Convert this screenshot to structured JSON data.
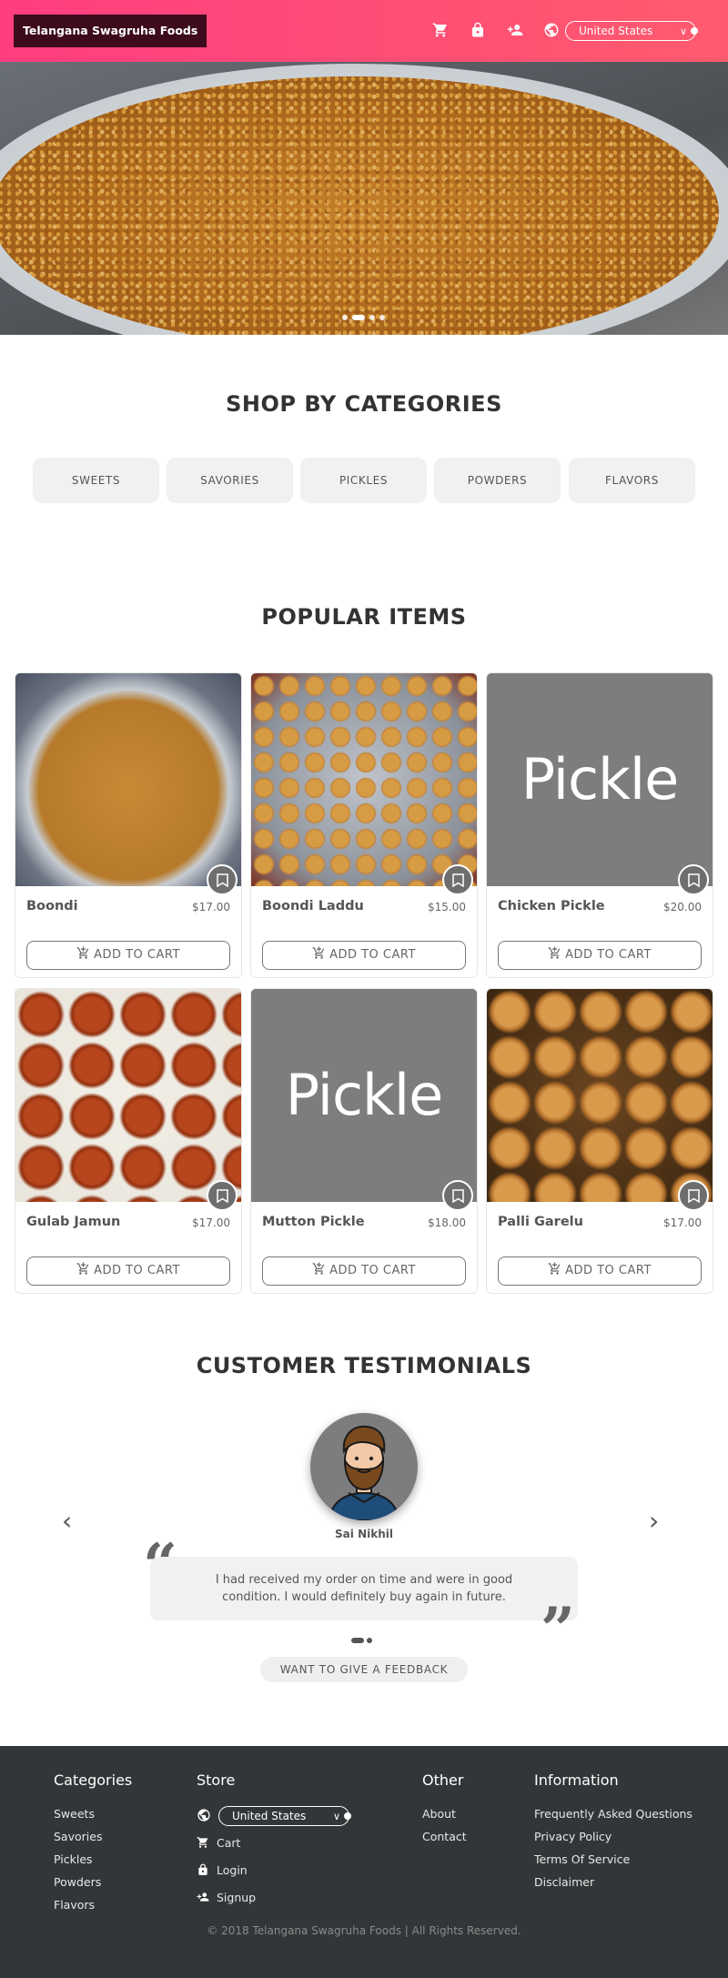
{
  "header": {
    "brand": "Telangana Swagruha Foods",
    "country": "United States",
    "icons": [
      "cart-icon",
      "lock-icon",
      "add-user-icon",
      "globe-icon"
    ]
  },
  "hero": {
    "slides": 4,
    "active_slide": 2
  },
  "categories": {
    "title": "SHOP BY CATEGORIES",
    "items": [
      "SWEETS",
      "SAVORIES",
      "PICKLES",
      "POWDERS",
      "FLAVORS"
    ]
  },
  "popular": {
    "title": "POPULAR ITEMS",
    "add_label": "ADD TO CART",
    "items": [
      {
        "name": "Boondi",
        "price": "$17.00",
        "image": "boondi"
      },
      {
        "name": "Boondi Laddu",
        "price": "$15.00",
        "image": "laddu"
      },
      {
        "name": "Chicken Pickle",
        "price": "$20.00",
        "image": "pickle",
        "image_text": "Pickle"
      },
      {
        "name": "Gulab Jamun",
        "price": "$17.00",
        "image": "jamun"
      },
      {
        "name": "Mutton Pickle",
        "price": "$18.00",
        "image": "pickle",
        "image_text": "Pickle"
      },
      {
        "name": "Palli Garelu",
        "price": "$17.00",
        "image": "garelu"
      }
    ]
  },
  "testimonials": {
    "title": "CUSTOMER TESTIMONIALS",
    "name": "Sai Nikhil",
    "quote": "I had received my order on time and were in good condition. I would definitely buy again in future.",
    "slides": 2,
    "active_slide": 1,
    "feedback_label": "WANT TO GIVE A FEEDBACK"
  },
  "footer": {
    "categories": {
      "title": "Categories",
      "links": [
        "Sweets",
        "Savories",
        "Pickles",
        "Powders",
        "Flavors"
      ]
    },
    "store": {
      "title": "Store",
      "country": "United States",
      "links": [
        "Cart",
        "Login",
        "Signup"
      ]
    },
    "other": {
      "title": "Other",
      "links": [
        "About",
        "Contact"
      ]
    },
    "information": {
      "title": "Information",
      "links": [
        "Frequently Asked Questions",
        "Privacy Policy",
        "Terms Of Service",
        "Disclaimer"
      ]
    },
    "copyright": "© 2018 Telangana Swagruha Foods | All Rights Reserved."
  },
  "colors": {
    "header_gradient_start": "#ff3d7f",
    "header_gradient_end": "#ff5b6e",
    "footer_bg": "#333638"
  }
}
